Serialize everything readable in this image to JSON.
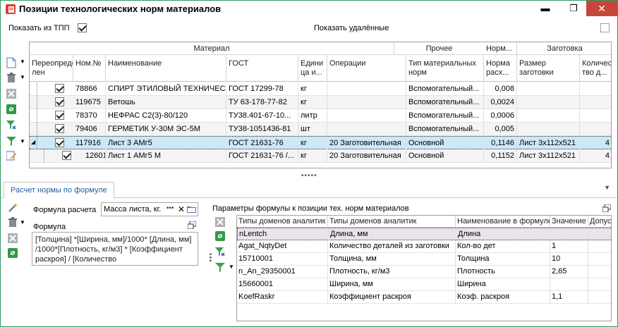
{
  "window": {
    "title": "Позиции технологических норм материалов",
    "minimize": "▬",
    "restore": "❐",
    "close": "✕"
  },
  "options": {
    "show_tpp_label": "Показать из ТПП",
    "show_tpp_checked": true,
    "show_deleted_label": "Показать удалённые",
    "show_deleted_checked": false
  },
  "grid1": {
    "bands": {
      "material": "Материал",
      "other": "Прочее",
      "norm": "Норм...",
      "blank": "Заготовка"
    },
    "headers": {
      "override": "Переопреде\nлен",
      "nom": "Ном.№",
      "name": "Наименование",
      "gost": "ГОСТ",
      "unit": "Едини\nца и...",
      "ops": "Операции",
      "type": "Тип материальных\nнорм",
      "norm": "Норма\nрасх...",
      "blank_size": "Размер\nзаготовки",
      "qty": "Количес\nтво д..."
    },
    "rows": [
      {
        "checked": true,
        "nom": "78866",
        "name": "СПИРТ ЭТИЛОВЫЙ ТЕХНИЧЕСК...",
        "gost": "ГОСТ 17299-78",
        "unit": "кг",
        "ops": "",
        "type": "Вспомогательный...",
        "norm": "0,008",
        "blank_size": "",
        "qty": ""
      },
      {
        "checked": true,
        "nom": "119675",
        "name": "Ветошь",
        "gost": "ТУ 63-178-77-82",
        "unit": "кг",
        "ops": "",
        "type": "Вспомогательный...",
        "norm": "0,0024",
        "blank_size": "",
        "qty": ""
      },
      {
        "checked": true,
        "nom": "78370",
        "name": "НЕФРАС С2(3)-80/120",
        "gost": "ТУ38.401-67-10...",
        "unit": "литр",
        "ops": "",
        "type": "Вспомогательный...",
        "norm": "0,0006",
        "blank_size": "",
        "qty": ""
      },
      {
        "checked": true,
        "nom": "79406",
        "name": "ГЕРМЕТИК У-30М ЭС-5М",
        "gost": "ТУ38-1051436-81",
        "unit": "шт",
        "ops": "",
        "type": "Вспомогательный...",
        "norm": "0,005",
        "blank_size": "",
        "qty": ""
      },
      {
        "checked": true,
        "nom": "117916",
        "name": "Лист 3 АМг5",
        "gost": "ГОСТ 21631-76",
        "unit": "кг",
        "ops": "20 Заготовительная",
        "type": "Основной",
        "norm": "0,1146",
        "blank_size": "Лист 3х112х521",
        "qty": "4"
      },
      {
        "checked": true,
        "nom": "126010",
        "name": "Лист 1 АМг5 М",
        "gost": "ГОСТ 21631-76 /...",
        "unit": "кг",
        "ops": "20 Заготовительная",
        "type": "Основной",
        "norm": "0,1152",
        "blank_size": "Лист 3х112х521",
        "qty": "4"
      }
    ]
  },
  "tab": {
    "label": "Расчет нормы по формуле"
  },
  "formula": {
    "calc_label": "Формула расчета",
    "calc_value": "Масса листа, кг.",
    "formula_label": "Формула",
    "formula_text": "[Толщина] *[Ширина, мм]/1000* [Длина, мм] /1000*[Плотность, кг/м3] * [Коэффициент раскроя] / [Количество"
  },
  "params": {
    "title": "Параметры формулы к позиции тех. норм материалов",
    "headers": {
      "domain_type": "Типы доменов аналитик",
      "domain_type2": "Типы доменов аналитик",
      "formula_name": "Наименование в формуле",
      "value": "Значение",
      "tolerance": "Допуск"
    },
    "rows": [
      {
        "domain_type": "nLentch",
        "domain_type2": "Длина, мм",
        "formula_name": "Длина",
        "value": ""
      },
      {
        "domain_type": "Agat_NqtyDet",
        "domain_type2": "Количество деталей из заготовки",
        "formula_name": "Кол-во дет",
        "value": "1"
      },
      {
        "domain_type": "15710001",
        "domain_type2": "Толщина, мм",
        "formula_name": "Толщина",
        "value": "10"
      },
      {
        "domain_type": "n_An_29350001",
        "domain_type2": "Плотность, кг/м3",
        "formula_name": "Плотность",
        "value": "2,65"
      },
      {
        "domain_type": "15660001",
        "domain_type2": "Ширина, мм",
        "formula_name": "Ширина",
        "value": ""
      },
      {
        "domain_type": "KoefRaskr",
        "domain_type2": "Коэффициент раскроя",
        "formula_name": "Коэф. раскроя",
        "value": "1,1"
      }
    ]
  },
  "colors": {
    "accent": "#1f5fa8",
    "selected_row": "#cde8f7",
    "close_btn": "#c7463c",
    "border": "#2f9a60"
  }
}
